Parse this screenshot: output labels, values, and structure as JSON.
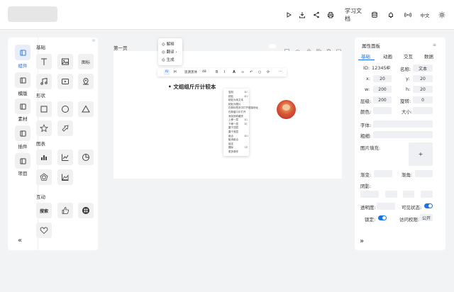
{
  "toolbar": {
    "docs_label": "学习文档",
    "lang_label": "中文",
    "icons": [
      "play-icon",
      "download-icon",
      "share-icon",
      "print-icon",
      "database-icon",
      "bell-icon",
      "broadcast-icon",
      "sun-icon"
    ]
  },
  "left_tabs": [
    {
      "label": "组件",
      "active": true
    },
    {
      "label": "模版",
      "active": false
    },
    {
      "label": "素材",
      "active": false
    },
    {
      "label": "插件",
      "active": false
    },
    {
      "label": "项目",
      "active": false
    }
  ],
  "sections": {
    "basic": "基础",
    "shape": "形状",
    "chart": "图表",
    "interact": "互动"
  },
  "components": {
    "icon_label": "图标",
    "search_label": "搜索"
  },
  "collapse_label": "«",
  "canvas": {
    "page_label": "第一页",
    "text": "文组组斤斤计较本",
    "font_name": "思源黑体",
    "font_size": "48"
  },
  "ai_menu": {
    "items": [
      "解释",
      "翻译",
      "生成"
    ]
  },
  "context_menu": {
    "rows": [
      {
        "label": "复制",
        "key": "⌘C"
      },
      {
        "label": "粘贴",
        "key": "⌘V"
      },
      {
        "label": "粘贴为纯文本",
        "key": ""
      },
      {
        "label": "粘贴为图片",
        "key": ""
      },
      {
        "label": "在新标签页中打开链接地址",
        "key": ""
      },
      {
        "label": "在新窗口中打开",
        "key": ""
      },
      {
        "label": "添加到收藏夹",
        "key": ""
      },
      {
        "label": "上移一层",
        "key": "⌘]"
      },
      {
        "label": "下移一层",
        "key": "⌘["
      },
      {
        "label": "置于顶层",
        "key": ""
      },
      {
        "label": "置于底层",
        "key": ""
      },
      {
        "label": "组合",
        "key": "⌘G"
      },
      {
        "label": "取消组合",
        "key": ""
      },
      {
        "label": "锁定",
        "key": ""
      },
      {
        "label": "删除",
        "key": "⌫"
      },
      {
        "label": "更多操作",
        "key": ""
      }
    ]
  },
  "props": {
    "title": "属性面板",
    "tabs": [
      "基础",
      "动画",
      "交互",
      "数据"
    ],
    "active_tab": "基础",
    "id_label": "ID:",
    "id_value": "123456",
    "name_label": "名称:",
    "name_value": "文本",
    "x_label": "x:",
    "x_value": "20",
    "y_label": "y:",
    "y_value": "20",
    "w_label": "w:",
    "w_value": "200",
    "h_label": "h:",
    "h_value": "20",
    "layer_label": "层级:",
    "layer_value": "200",
    "rotate_label": "旋转:",
    "rotate_value": "0",
    "color_label": "颜色:",
    "size_label": "大小:",
    "font_label": "字体:",
    "bold_label": "粗细:",
    "fill_label": "图片填充:",
    "fill_add": "+",
    "gradient_label": "渐变:",
    "radius_label": "渐角:",
    "shadow_label": "阴影:",
    "opacity_label": "透明度:",
    "visible_label": "可见状态:",
    "lock_label": "锁定:",
    "access_label": "访问权限:",
    "access_value": "公开",
    "expand_label": "»"
  },
  "colors": {
    "accent": "#1a73e8"
  }
}
